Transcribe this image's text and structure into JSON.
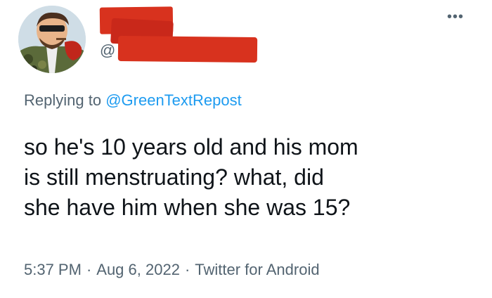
{
  "header": {
    "handle_prefix": "@",
    "more_glyph": "•••"
  },
  "reply": {
    "prefix": "Replying to",
    "mention": "@GreenTextRepost"
  },
  "tweet": {
    "lines": [
      "so he's 10 years old and his mom",
      "is still menstruating? what, did",
      "she have him when she was 15?"
    ]
  },
  "meta": {
    "time": "5:37 PM",
    "separator": "·",
    "date": "Aug 6, 2022",
    "source": "Twitter for Android"
  },
  "colors": {
    "text": "#0f1419",
    "secondary": "#536471",
    "link": "#1d9bf0",
    "redaction": "#d8321e"
  },
  "icons": {
    "more": "more-horizontal-icon"
  }
}
